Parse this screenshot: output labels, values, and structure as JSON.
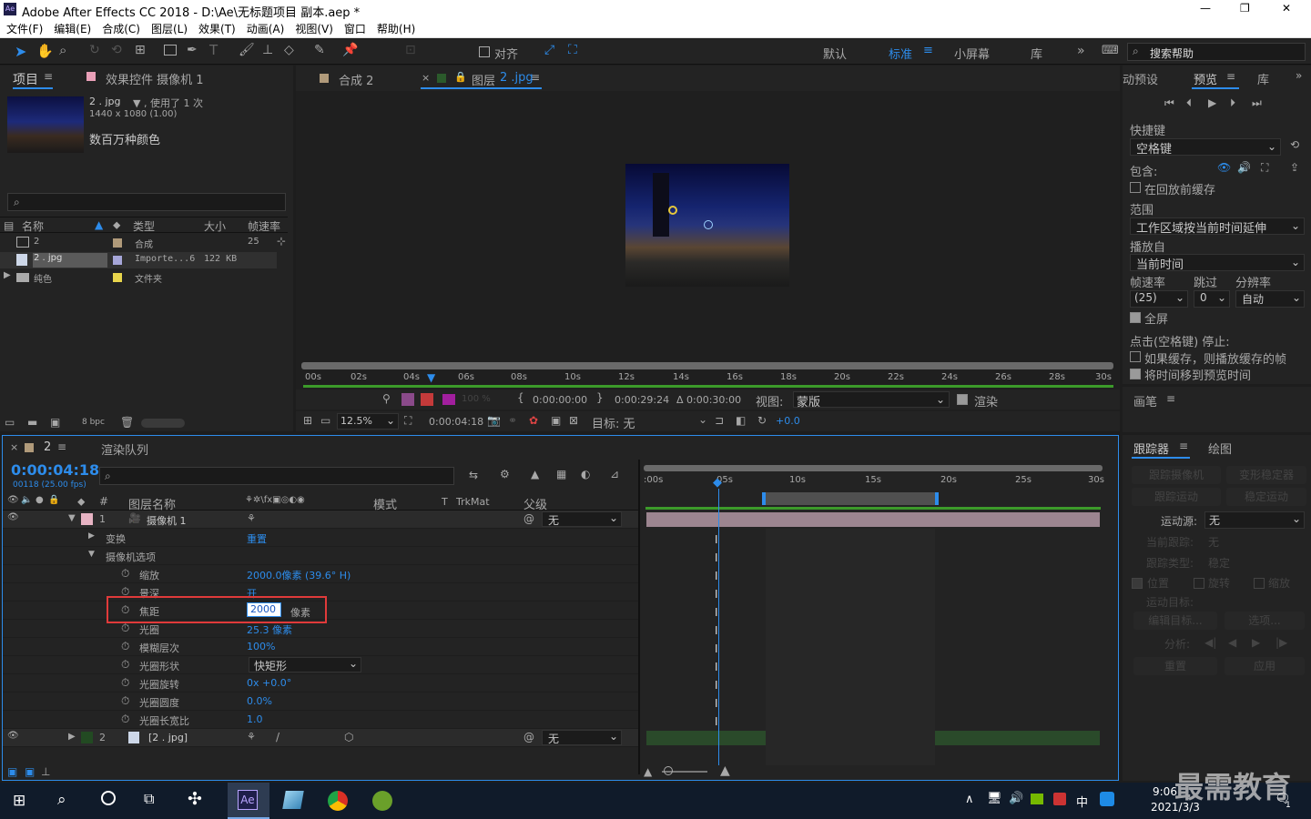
{
  "window": {
    "title": "Adobe After Effects CC 2018 - D:\\Ae\\无标题项目 副本.aep *",
    "min": "—",
    "max": "❐",
    "close": "✕",
    "logo": "Ae"
  },
  "menu": [
    "文件(F)",
    "编辑(E)",
    "合成(C)",
    "图层(L)",
    "效果(T)",
    "动画(A)",
    "视图(V)",
    "窗口",
    "帮助(H)"
  ],
  "toolbar": {
    "snap": "对齐",
    "workspaces": [
      "默认",
      "标准",
      "小屏幕",
      "库"
    ],
    "search_placeholder": "搜索帮助"
  },
  "project": {
    "tab": "项目",
    "effects_tab": "效果控件 摄像机 1",
    "item_name": "2 . jpg",
    "used": "▼ , 使用了 1 次",
    "dims": "1440 x 1080 (1.00)",
    "colors": "数百万种颜色",
    "headers": [
      "名称",
      "类型",
      "大小",
      "帧速率"
    ],
    "rows": [
      {
        "name": "2",
        "type": "合成",
        "size": "",
        "fps": "25"
      },
      {
        "name": "2 . jpg",
        "type": "Importe...6",
        "size": "122 KB",
        "fps": ""
      },
      {
        "name": "纯色",
        "type": "文件夹",
        "size": "",
        "fps": ""
      }
    ],
    "bpc": "8 bpc"
  },
  "comp": {
    "tab1": "合成 2",
    "tab2": "图层",
    "tab2_link": "2 .jpg",
    "ruler": [
      "00s",
      "02s",
      "04s",
      "06s",
      "08s",
      "10s",
      "12s",
      "14s",
      "16s",
      "18s",
      "20s",
      "22s",
      "24s",
      "26s",
      "28s",
      "30s"
    ],
    "in": "0:00:00:00",
    "out": "0:00:29:24",
    "dur": "Δ 0:00:30:00",
    "view_label": "视图:",
    "view": "蒙版",
    "render": "渲染",
    "zoom": "12.5%",
    "time": "0:00:04:18",
    "target": "目标: 无",
    "offset": "+0.0",
    "opacity": "100 %"
  },
  "preview": {
    "tabs": [
      "动预设",
      "预览",
      "库"
    ],
    "shortcut_label": "快捷键",
    "shortcut": "空格键",
    "include": "包含:",
    "cache": "在回放前缓存",
    "range_label": "范围",
    "range": "工作区域按当前时间延伸",
    "from_label": "播放自",
    "from": "当前时间",
    "fps_label": "帧速率",
    "skip_label": "跳过",
    "res_label": "分辨率",
    "fps": "(25)",
    "skip": "0",
    "res": "自动",
    "fullscreen": "全屏",
    "stop_label": "点击(空格键) 停止:",
    "stop1": "如果缓存，则播放缓存的帧",
    "stop2": "将时间移到预览时间",
    "brush": "画笔"
  },
  "tracker": {
    "tabs": [
      "跟踪器",
      "绘图"
    ],
    "btns": [
      "跟踪摄像机",
      "变形稳定器",
      "跟踪运动",
      "稳定运动"
    ],
    "source_label": "运动源:",
    "source": "无",
    "cur_label": "当前跟踪:",
    "cur": "无",
    "type_label": "跟踪类型:",
    "type": "稳定",
    "pos": "位置",
    "rot": "旋转",
    "scale": "缩放",
    "target_label": "运动目标:",
    "edit": "编辑目标...",
    "options": "选项...",
    "analyze": "分析:",
    "reset": "重置",
    "apply": "应用"
  },
  "timeline": {
    "tab_close": "×",
    "tab": "2",
    "render_tab": "渲染队列",
    "time": "0:00:04:18",
    "frames": "00118 (25.00 fps)",
    "col_name": "图层名称",
    "col_mode": "模式",
    "col_t": "T",
    "col_trk": "TrkMat",
    "col_parent": "父级",
    "ruler": [
      ":00s",
      "05s",
      "10s",
      "15s",
      "20s",
      "25s",
      "30s"
    ],
    "layers": [
      {
        "num": "1",
        "name": "摄像机 1",
        "parent": "无"
      },
      {
        "num": "2",
        "name": "[2 . jpg]",
        "parent": "无"
      }
    ],
    "props": [
      {
        "name": "变换",
        "val": "重置"
      },
      {
        "name": "摄像机选项",
        "val": ""
      },
      {
        "name": "缩放",
        "val": "2000.0像素 (39.6° H)"
      },
      {
        "name": "景深",
        "val": "开"
      },
      {
        "name": "焦距",
        "val": "2000",
        "unit": "像素"
      },
      {
        "name": "光圈",
        "val": "25.3 像素"
      },
      {
        "name": "模糊层次",
        "val": "100%"
      },
      {
        "name": "光圈形状",
        "val": "快矩形"
      },
      {
        "name": "光圈旋转",
        "val": "0x +0.0°"
      },
      {
        "name": "光圈圆度",
        "val": "0.0%"
      },
      {
        "name": "光圈长宽比",
        "val": "1.0"
      }
    ]
  },
  "taskbar": {
    "time": "9:06",
    "date": "2021/3/3",
    "ime": "中",
    "watermark": "最需教育",
    "notif": "1"
  }
}
